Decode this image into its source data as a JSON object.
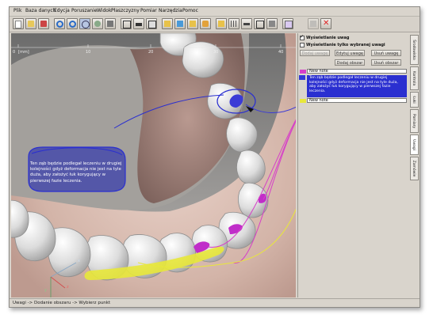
{
  "menu": [
    "Plik",
    "Baza danych",
    "Edycja",
    "Poruszanie",
    "Widok",
    "Płaszczyzny",
    "Pomiar",
    "Narzędzia",
    "Pomoc"
  ],
  "toolbar_icons": [
    "new-file-icon",
    "open-folder-icon",
    "save-icon",
    "undo-icon",
    "redo-icon",
    "rotate-icon",
    "pan-icon",
    "zoom-icon",
    "view-front-icon",
    "view-side-icon",
    "view-top-icon",
    "layers-icon",
    "measure-icon",
    "section-icon",
    "tooth-icon",
    "plane-icon",
    "grid-icon",
    "ruler-icon",
    "hide-icon",
    "fit-icon",
    "note-icon",
    "close-icon"
  ],
  "ruler": {
    "ticks": [
      "0",
      "10",
      "20",
      "30",
      "40"
    ],
    "unit": "[mm]"
  },
  "panel": {
    "show_notes": "Wyświetlanie uwag",
    "show_selected": "Wyświetlanie tylko wybranej uwagi",
    "buttons": {
      "add_note": "Dodaj uwagę",
      "edit_note": "Edytuj uwagę",
      "remove_note": "Usuń uwagę",
      "add_area": "Dodaj obszar",
      "remove_area": "Usuń obszar"
    },
    "notes": [
      {
        "label": "New note",
        "color": "#d63fc8"
      },
      {
        "label": "Ten ząb będzie podlegał leczeniu w drugiej kolejności gdyż deformacja nie jest na tyle duża, aby założyć łuk korygujący w pierwszej fazie leczenia.",
        "color": "#3238d6"
      },
      {
        "label": "New note",
        "color": "#e8e83a"
      }
    ]
  },
  "vtabs": [
    "Środowisko",
    "Kontrola",
    "Łuki",
    "Pomiary",
    "Uwagi",
    "Zamówie"
  ],
  "callout": "Ten ząb będzie podlegał leczeniu w drugiej kolejności gdyż deformacja nie jest na tyle duża, aby założyć łuk korygujący w pierwszej fazie leczenia.",
  "status": "Uwagi -> Dodanie obszaru -> Wybierz punkt",
  "axes": {
    "x": "x",
    "y": "y",
    "z": "z"
  }
}
